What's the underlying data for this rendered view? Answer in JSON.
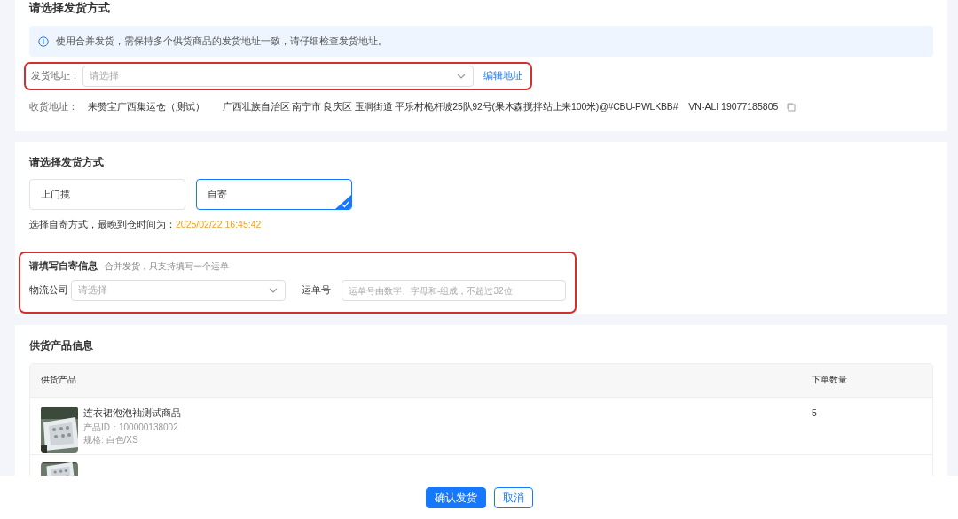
{
  "address_section": {
    "title": "请选择发货方式",
    "notice": "使用合并发货，需保持多个供货商品的发货地址一致，请仔细检查发货地址。",
    "ship_from": {
      "label": "发货地址：",
      "placeholder": "请选择",
      "edit_link": "编辑地址"
    },
    "receive": {
      "label": "收货地址：",
      "name": "来赞宝广西集运仓（测试）",
      "address": "广西壮族自治区 南宁市 良庆区 玉洞街道 平乐村桅杆坡25队92号(果木森搅拌站上来100米)@#CBU-PWLKBB#",
      "contact": "VN-ALI 19077185805"
    }
  },
  "method_section": {
    "title": "请选择发货方式",
    "options": [
      {
        "label": "上门揽",
        "selected": false
      },
      {
        "label": "自寄",
        "selected": true
      }
    ],
    "deadline_label": "选择自寄方式，最晚到仓时间为：",
    "deadline": "2025/02/22 16:45:42",
    "self_ship": {
      "title": "请填写自寄信息",
      "hint": "合并发货，只支持填写一个运单",
      "carrier": {
        "label": "物流公司",
        "placeholder": "请选择"
      },
      "tracking": {
        "label": "运单号",
        "placeholder": "运单号由数字、字母和-组成，不超过32位"
      }
    }
  },
  "product_section": {
    "title": "供货产品信息",
    "columns": [
      "供货产品",
      "下单数量"
    ],
    "rows": [
      {
        "name": "连衣裙泡泡袖测试商品",
        "product_id": "产品ID：100000138002",
        "spec": "规格: 白色/XS",
        "quantity": "5"
      }
    ]
  },
  "footer": {
    "buttons": [
      {
        "label": "确认发货",
        "kind": "primary"
      },
      {
        "label": "取消",
        "kind": "secondary"
      }
    ]
  }
}
